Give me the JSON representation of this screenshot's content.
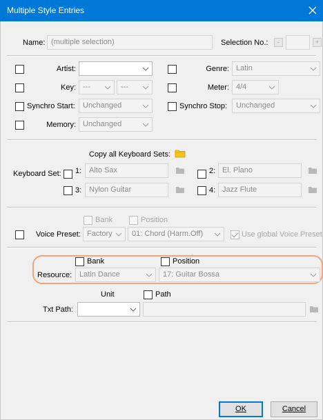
{
  "window": {
    "title": "Multiple Style Entries",
    "close_label": "✕"
  },
  "name_row": {
    "name_label": "Name:",
    "name_value": "(multiple selection)",
    "selection_label": "Selection No.:",
    "selection_value": "",
    "minus": "-",
    "plus": "+"
  },
  "fields": {
    "artist_label": "Artist:",
    "artist_value": "",
    "genre_label": "Genre:",
    "genre_value": "Latin",
    "key_label": "Key:",
    "key_value_1": "---",
    "key_value_2": "---",
    "meter_label": "Meter:",
    "meter_value": "4/4",
    "synchro_start_label": "Synchro Start:",
    "synchro_start_value": "Unchanged",
    "synchro_stop_label": "Synchro Stop:",
    "synchro_stop_value": "Unchanged",
    "memory_label": "Memory:",
    "memory_value": "Unchanged"
  },
  "keyboard": {
    "copy_all_label": "Copy all Keyboard Sets:",
    "set_label": "Keyboard Set:",
    "sets": [
      {
        "num": "1:",
        "value": "Alto Sax"
      },
      {
        "num": "2:",
        "value": "El. Piano"
      },
      {
        "num": "3:",
        "value": "Nylon Guitar"
      },
      {
        "num": "4:",
        "value": "Jazz Flute"
      }
    ]
  },
  "voice": {
    "bank_label": "Bank",
    "position_label": "Position",
    "label": "Voice Preset:",
    "bank_value": "Factory",
    "position_value": "01: Chord (Harm.Off)",
    "use_global_label": "Use global Voice Preset"
  },
  "resource": {
    "bank_label": "Bank",
    "position_label": "Position",
    "label": "Resource:",
    "bank_value": "Latin Dance",
    "position_value": "17: Guitar Bossa"
  },
  "txt": {
    "unit_label": "Unit",
    "path_check_label": "Path",
    "label": "Txt Path:",
    "unit_value": "",
    "path_value": ""
  },
  "buttons": {
    "ok_label": "OK",
    "cancel_label": "Cancel"
  },
  "colors": {
    "titlebar": "#0078d7",
    "highlight": "#f0a57a",
    "folder": "#f5c518"
  }
}
